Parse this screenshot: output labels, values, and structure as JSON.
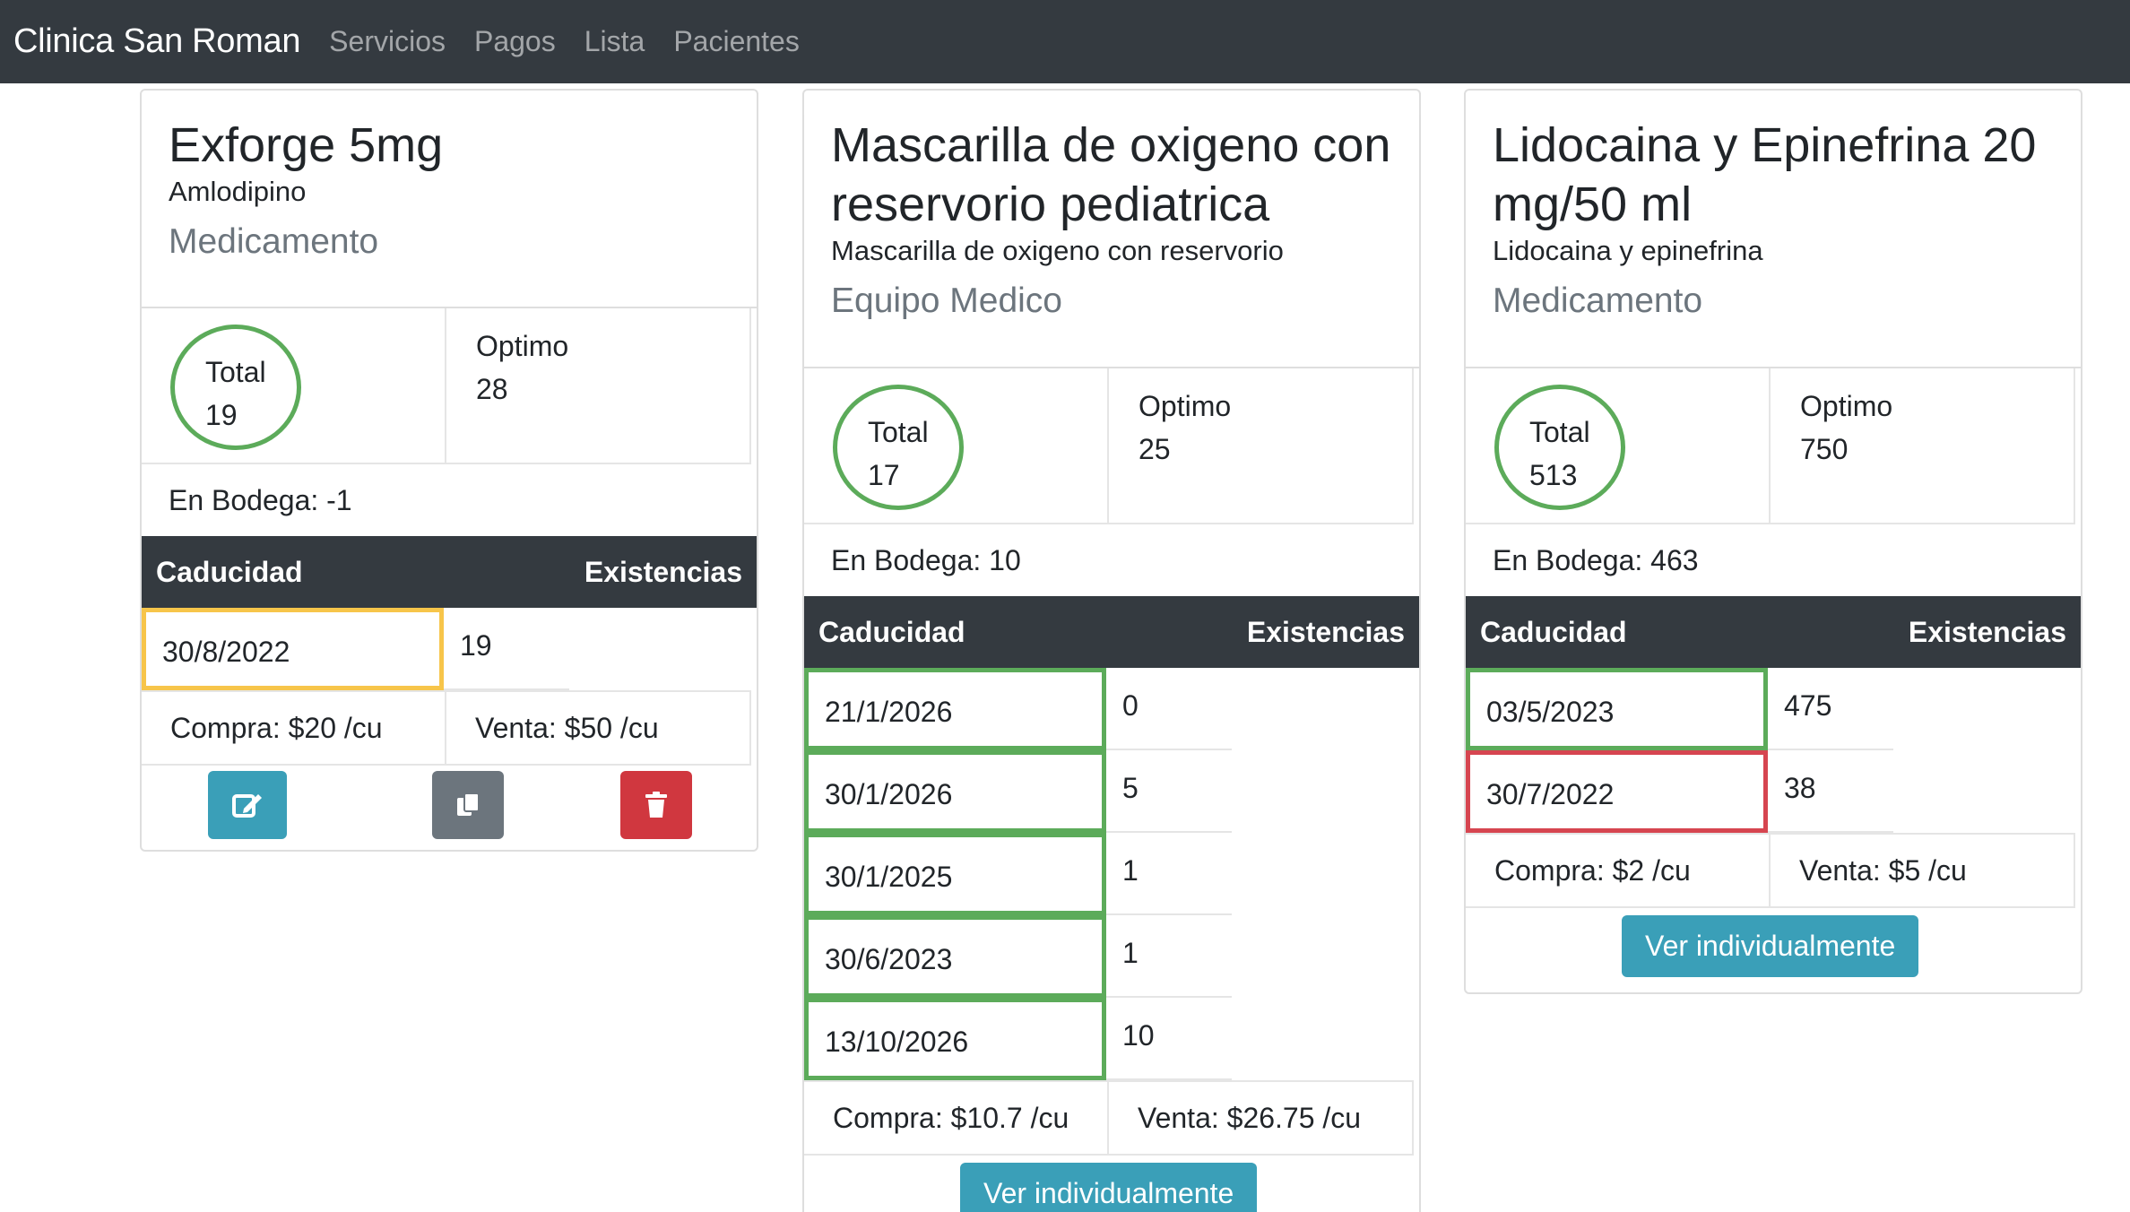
{
  "nav": {
    "brand": "Clinica San Roman",
    "links": [
      "Servicios",
      "Pagos",
      "Lista",
      "Pacientes"
    ]
  },
  "labels": {
    "total": "Total",
    "optimo": "Optimo",
    "caducidad": "Caducidad",
    "existencias": "Existencias",
    "ver": "Ver individualmente"
  },
  "cards": [
    {
      "title": "Exforge 5mg",
      "subtitle": "Amlodipino",
      "category": "Medicamento",
      "total": "19",
      "optimo": "28",
      "bodega": "En Bodega: -1",
      "rows": [
        {
          "date": "30/8/2022",
          "qty": "19",
          "status": "warning"
        }
      ],
      "compra": "Compra: $20 /cu",
      "venta": "Venta: $50 /cu"
    },
    {
      "title": "Mascarilla de oxigeno con reservorio pediatrica",
      "subtitle": "Mascarilla de oxigeno con reservorio",
      "category": "Equipo Medico",
      "total": "17",
      "optimo": "25",
      "bodega": "En Bodega: 10",
      "rows": [
        {
          "date": "21/1/2026",
          "qty": "0",
          "status": "ok"
        },
        {
          "date": "30/1/2026",
          "qty": "5",
          "status": "ok"
        },
        {
          "date": "30/1/2025",
          "qty": "1",
          "status": "ok"
        },
        {
          "date": "30/6/2023",
          "qty": "1",
          "status": "ok"
        },
        {
          "date": "13/10/2026",
          "qty": "10",
          "status": "ok"
        }
      ],
      "compra": "Compra: $10.7 /cu",
      "venta": "Venta: $26.75 /cu"
    },
    {
      "title": "Lidocaina y Epinefrina 20 mg/50 ml",
      "subtitle": "Lidocaina y epinefrina",
      "category": "Medicamento",
      "total": "513",
      "optimo": "750",
      "bodega": "En Bodega: 463",
      "rows": [
        {
          "date": "03/5/2023",
          "qty": "475",
          "status": "ok"
        },
        {
          "date": "30/7/2022",
          "qty": "38",
          "status": "danger"
        }
      ],
      "compra": "Compra: $2 /cu",
      "venta": "Venta: $5 /cu"
    }
  ],
  "colors": {
    "navbar": "#343a40",
    "ok": "#5cab5a",
    "warning": "#f7c54a",
    "danger": "#d64550",
    "info": "#3a9fb8"
  }
}
